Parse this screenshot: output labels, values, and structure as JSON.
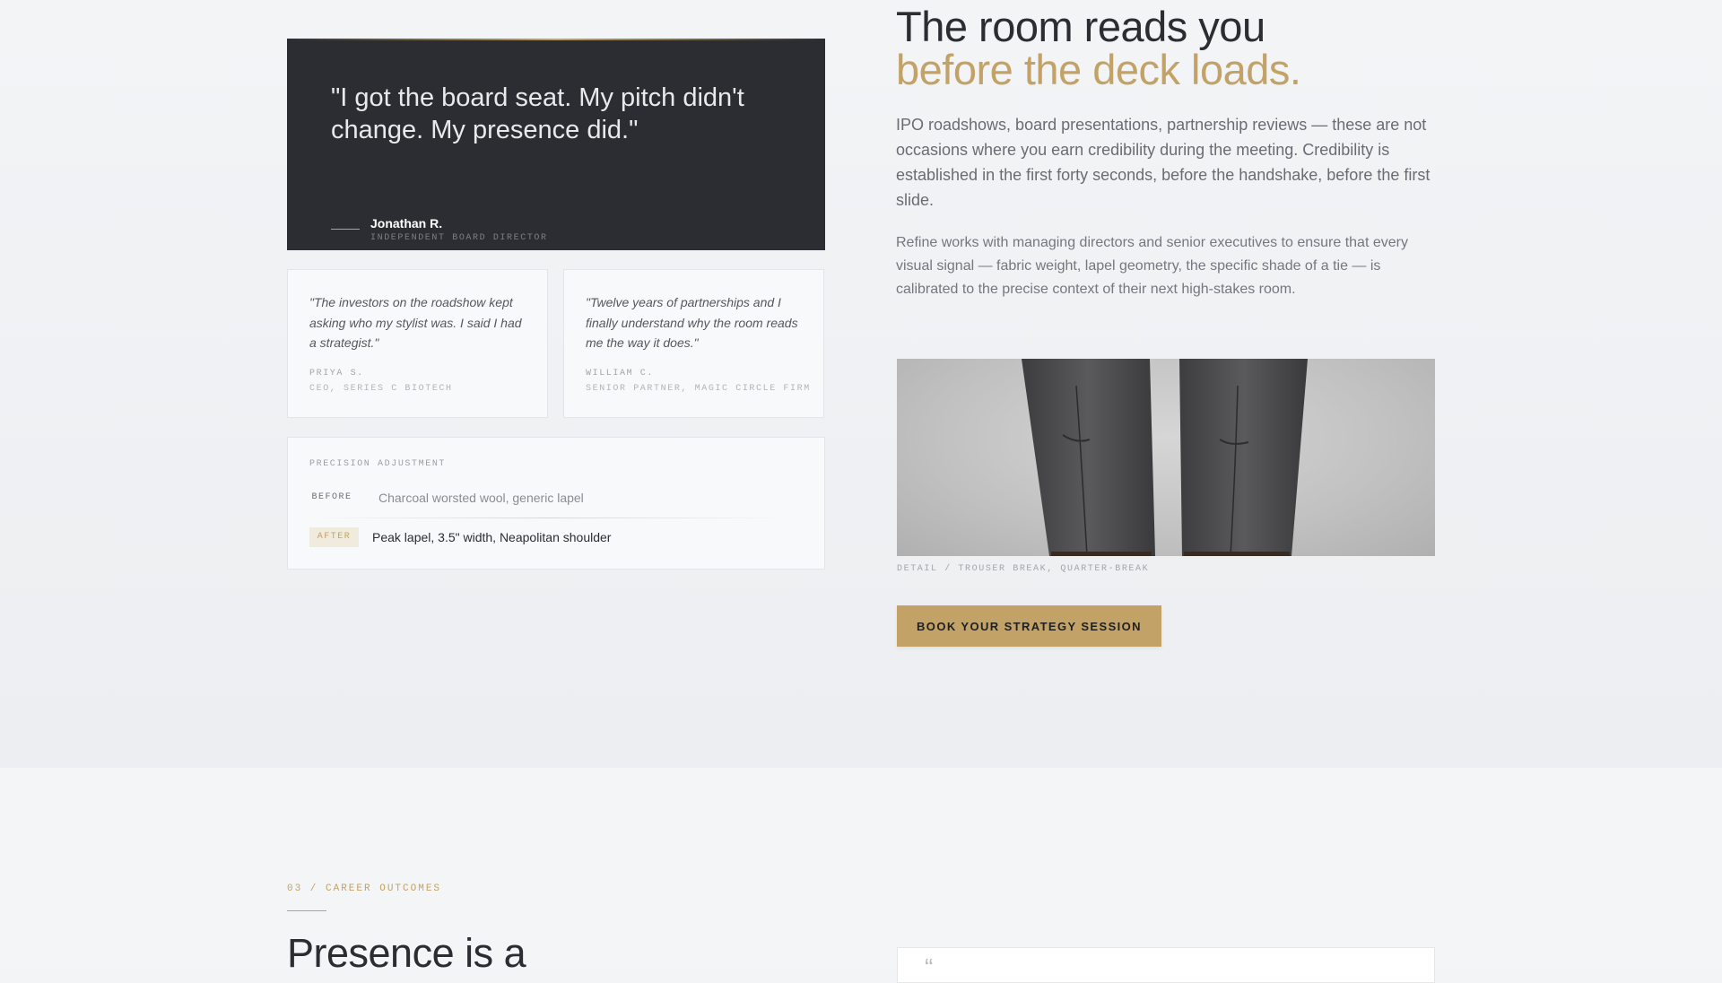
{
  "featured_testimonial": {
    "quote": "\"I got the board seat. My pitch didn't change. My presence did.\"",
    "name": "Jonathan R.",
    "role": "INDEPENDENT BOARD DIRECTOR"
  },
  "testimonials": [
    {
      "quote": "\"The investors on the roadshow kept asking who my stylist was. I said I had a strategist.\"",
      "name": "PRIYA S.",
      "title": "CEO, SERIES C BIOTECH"
    },
    {
      "quote": "\"Twelve years of partnerships and I finally understand why the room reads me the way it does.\"",
      "name": "WILLIAM C.",
      "title": "SENIOR PARTNER, MAGIC CIRCLE FIRM"
    }
  ],
  "precision": {
    "eyebrow": "PRECISION ADJUSTMENT",
    "before_label": "BEFORE",
    "before_text": "Charcoal worsted wool, generic lapel",
    "after_label": "AFTER",
    "after_text": "Peak lapel, 3.5\" width, Neapolitan shoulder"
  },
  "hero": {
    "headline_line1": "The room reads you",
    "headline_line2": "before the deck loads.",
    "lead": "IPO roadshows, board presentations, partnership reviews — these are not occasions where you earn credibility during the meeting. Credibility is established in the first forty seconds, before the handshake, before the first slide.",
    "body": "Refine works with managing directors and senior executives to ensure that every visual signal — fabric weight, lapel geometry, the specific shade of a tie — is calibrated to the precise context of their next high-stakes room."
  },
  "image": {
    "caption": "DETAIL / TROUSER BREAK, QUARTER-BREAK",
    "icon": "trouser-detail-photo"
  },
  "cta": {
    "label": "BOOK YOUR STRATEGY SESSION"
  },
  "next_section": {
    "label": "03 / CAREER OUTCOMES",
    "heading": "Presence is a",
    "card_mark": "“"
  },
  "colors": {
    "accent": "#c2a266",
    "dark": "#2c2d33",
    "background": "#f3f4f6"
  }
}
